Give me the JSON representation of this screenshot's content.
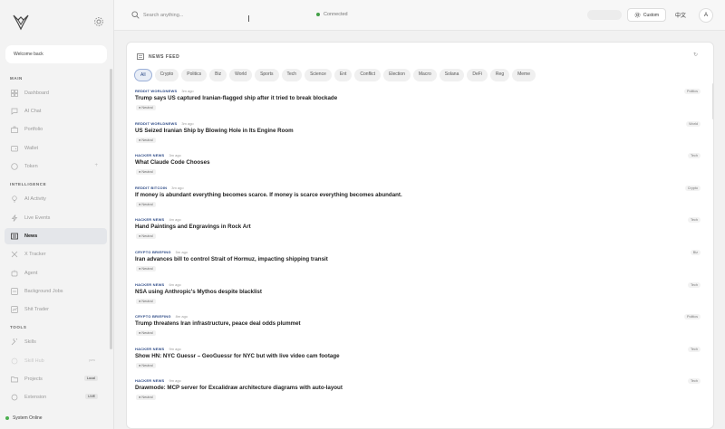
{
  "sidebar": {
    "welcome": "Welcome back",
    "sections": {
      "main": "MAIN",
      "intelligence": "INTELLIGENCE",
      "tools": "TOOLS"
    },
    "items": {
      "dashboard": "Dashboard",
      "ai_chat": "AI Chat",
      "portfolio": "Portfolio",
      "wallet": "Wallet",
      "token": "Token",
      "ai_activity": "AI Activity",
      "live_events": "Live Events",
      "news": "News",
      "x_tracker": "X Tracker",
      "agent": "Agent",
      "background_jobs": "Background Jobs",
      "shit_trader": "Shit Trader",
      "skills": "Skills",
      "skill_hub": "Skill Hub",
      "skill_hub_badge": "pww",
      "projects": "Projects",
      "projects_badge": "Local",
      "extension": "Extension",
      "extension_badge": "LIVE"
    },
    "status": "System Online"
  },
  "topbar": {
    "search_placeholder": "Search anything...",
    "connection": "Connected",
    "custom": "Custom",
    "language": "中文",
    "avatar": "A"
  },
  "feed": {
    "title": "NEWS FEED",
    "filters": [
      "All",
      "Crypto",
      "Politics",
      "Biz",
      "World",
      "Sports",
      "Tech",
      "Science",
      "Ent",
      "Conflict",
      "Election",
      "Macro",
      "Solana",
      "DeFi",
      "Reg",
      "Meme"
    ],
    "items": [
      {
        "source": "REDDIT WORLDNEWS",
        "time": "3m ago",
        "headline": "Trump says US captured Iranian-flagged ship after it tried to break blockade",
        "sentiment": "Neutral",
        "category": "Politics"
      },
      {
        "source": "REDDIT WORLDNEWS",
        "time": "3m ago",
        "headline": "US Seized Iranian Ship by Blowing Hole in Its Engine Room",
        "sentiment": "Neutral",
        "category": "World"
      },
      {
        "source": "HACKER NEWS",
        "time": "3m ago",
        "headline": "What Claude Code Chooses",
        "sentiment": "Neutral",
        "category": "Tech"
      },
      {
        "source": "REDDIT BITCOIN",
        "time": "3m ago",
        "headline": "If money is abundant everything becomes scarce. If money is scarce everything becomes abundant.",
        "sentiment": "Neutral",
        "category": "Crypto"
      },
      {
        "source": "HACKER NEWS",
        "time": "4m ago",
        "headline": "Hand Paintings and Engravings in Rock Art",
        "sentiment": "Neutral",
        "category": "Tech"
      },
      {
        "source": "CRYPTO BRIEFING",
        "time": "5m ago",
        "headline": "Iran advances bill to control Strait of Hormuz, impacting shipping transit",
        "sentiment": "Neutral",
        "category": "Biz"
      },
      {
        "source": "HACKER NEWS",
        "time": "6m ago",
        "headline": "NSA using Anthropic's Mythos despite blacklist",
        "sentiment": "Neutral",
        "category": "Tech"
      },
      {
        "source": "CRYPTO BRIEFING",
        "time": "8m ago",
        "headline": "Trump threatens Iran infrastructure, peace deal odds plummet",
        "sentiment": "Neutral",
        "category": "Politics"
      },
      {
        "source": "HACKER NEWS",
        "time": "9m ago",
        "headline": "Show HN: NYC Guessr – GeoGuessr for NYC but with live video cam footage",
        "sentiment": "Neutral",
        "category": "Tech"
      },
      {
        "source": "HACKER NEWS",
        "time": "9m ago",
        "headline": "Drawmode: MCP server for Excalidraw architecture diagrams with auto-layout",
        "sentiment": "Neutral",
        "category": "Tech"
      }
    ]
  },
  "colors": {
    "accent": "#2d4a86",
    "online": "#4caf50",
    "active_bg": "#e4e6ea"
  }
}
